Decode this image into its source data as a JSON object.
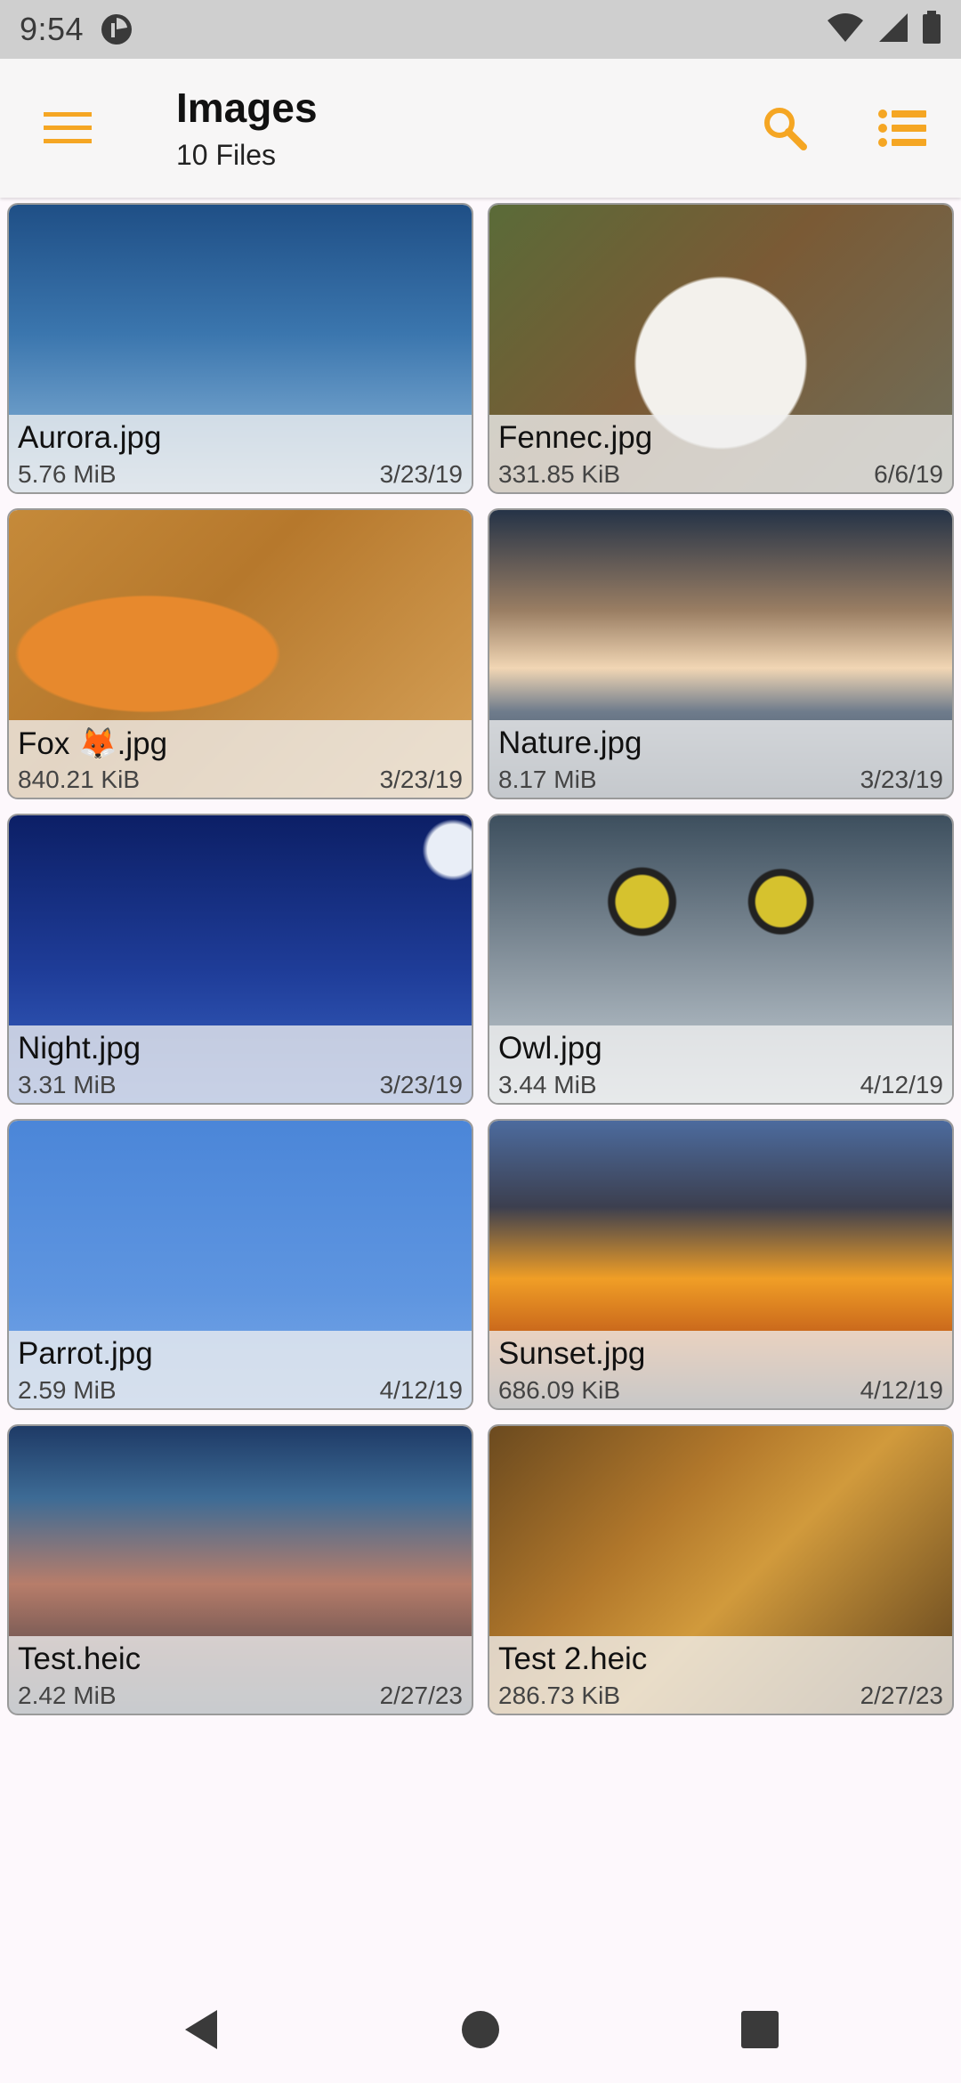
{
  "status_bar": {
    "time": "9:54",
    "app_icon": "pie-app-icon",
    "icons": [
      "wifi-icon",
      "cell-signal-icon",
      "battery-icon"
    ]
  },
  "app_bar": {
    "title": "Images",
    "subtitle": "10 Files",
    "menu_icon": "hamburger-menu-icon",
    "search_icon": "search-icon",
    "view_icon": "list-view-icon",
    "accent_color": "#f5a623"
  },
  "files": [
    {
      "name": "Aurora.jpg",
      "size": "5.76 MiB",
      "date": "3/23/19",
      "thumb": "aurora"
    },
    {
      "name": "Fennec.jpg",
      "size": "331.85 KiB",
      "date": "6/6/19",
      "thumb": "fennec"
    },
    {
      "name": "Fox 🦊.jpg",
      "size": "840.21 KiB",
      "date": "3/23/19",
      "thumb": "fox"
    },
    {
      "name": "Nature.jpg",
      "size": "8.17 MiB",
      "date": "3/23/19",
      "thumb": "nature"
    },
    {
      "name": "Night.jpg",
      "size": "3.31 MiB",
      "date": "3/23/19",
      "thumb": "night"
    },
    {
      "name": "Owl.jpg",
      "size": "3.44 MiB",
      "date": "4/12/19",
      "thumb": "owl"
    },
    {
      "name": "Parrot.jpg",
      "size": "2.59 MiB",
      "date": "4/12/19",
      "thumb": "parrot"
    },
    {
      "name": "Sunset.jpg",
      "size": "686.09 KiB",
      "date": "4/12/19",
      "thumb": "sunset"
    },
    {
      "name": "Test.heic",
      "size": "2.42 MiB",
      "date": "2/27/23",
      "thumb": "test"
    },
    {
      "name": "Test 2.heic",
      "size": "286.73 KiB",
      "date": "2/27/23",
      "thumb": "test2"
    }
  ],
  "nav_bar": {
    "back_icon": "back-triangle-icon",
    "home_icon": "home-circle-icon",
    "recents_icon": "recents-square-icon"
  }
}
